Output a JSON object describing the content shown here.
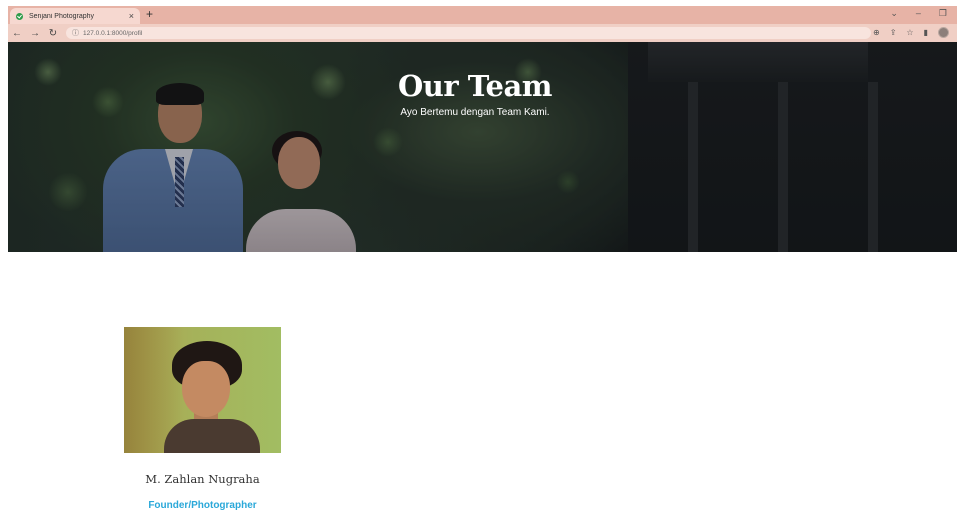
{
  "browser": {
    "tab_title": "Senjani Photography",
    "tab_close": "×",
    "new_tab": "+",
    "url": "127.0.0.1:8000/profil",
    "icons": [
      "back-icon",
      "forward-icon",
      "reload-icon",
      "info-icon",
      "zoom-icon",
      "share-icon",
      "star-icon",
      "sidebar-icon",
      "profile-icon"
    ],
    "window_controls": [
      "chevron-down-icon",
      "minimize-icon",
      "restore-icon",
      "close-icon"
    ]
  },
  "hero": {
    "title": "Our Team",
    "subtitle": "Ayo Bertemu dengan Team Kami."
  },
  "team": {
    "members": [
      {
        "name": "M. Zahlan Nugraha",
        "role": "Founder/Photographer"
      }
    ]
  },
  "colors": {
    "tab_bar": "#e7b3a6",
    "address_bar": "#f0cfc5",
    "role_accent": "#2aa8d9"
  }
}
